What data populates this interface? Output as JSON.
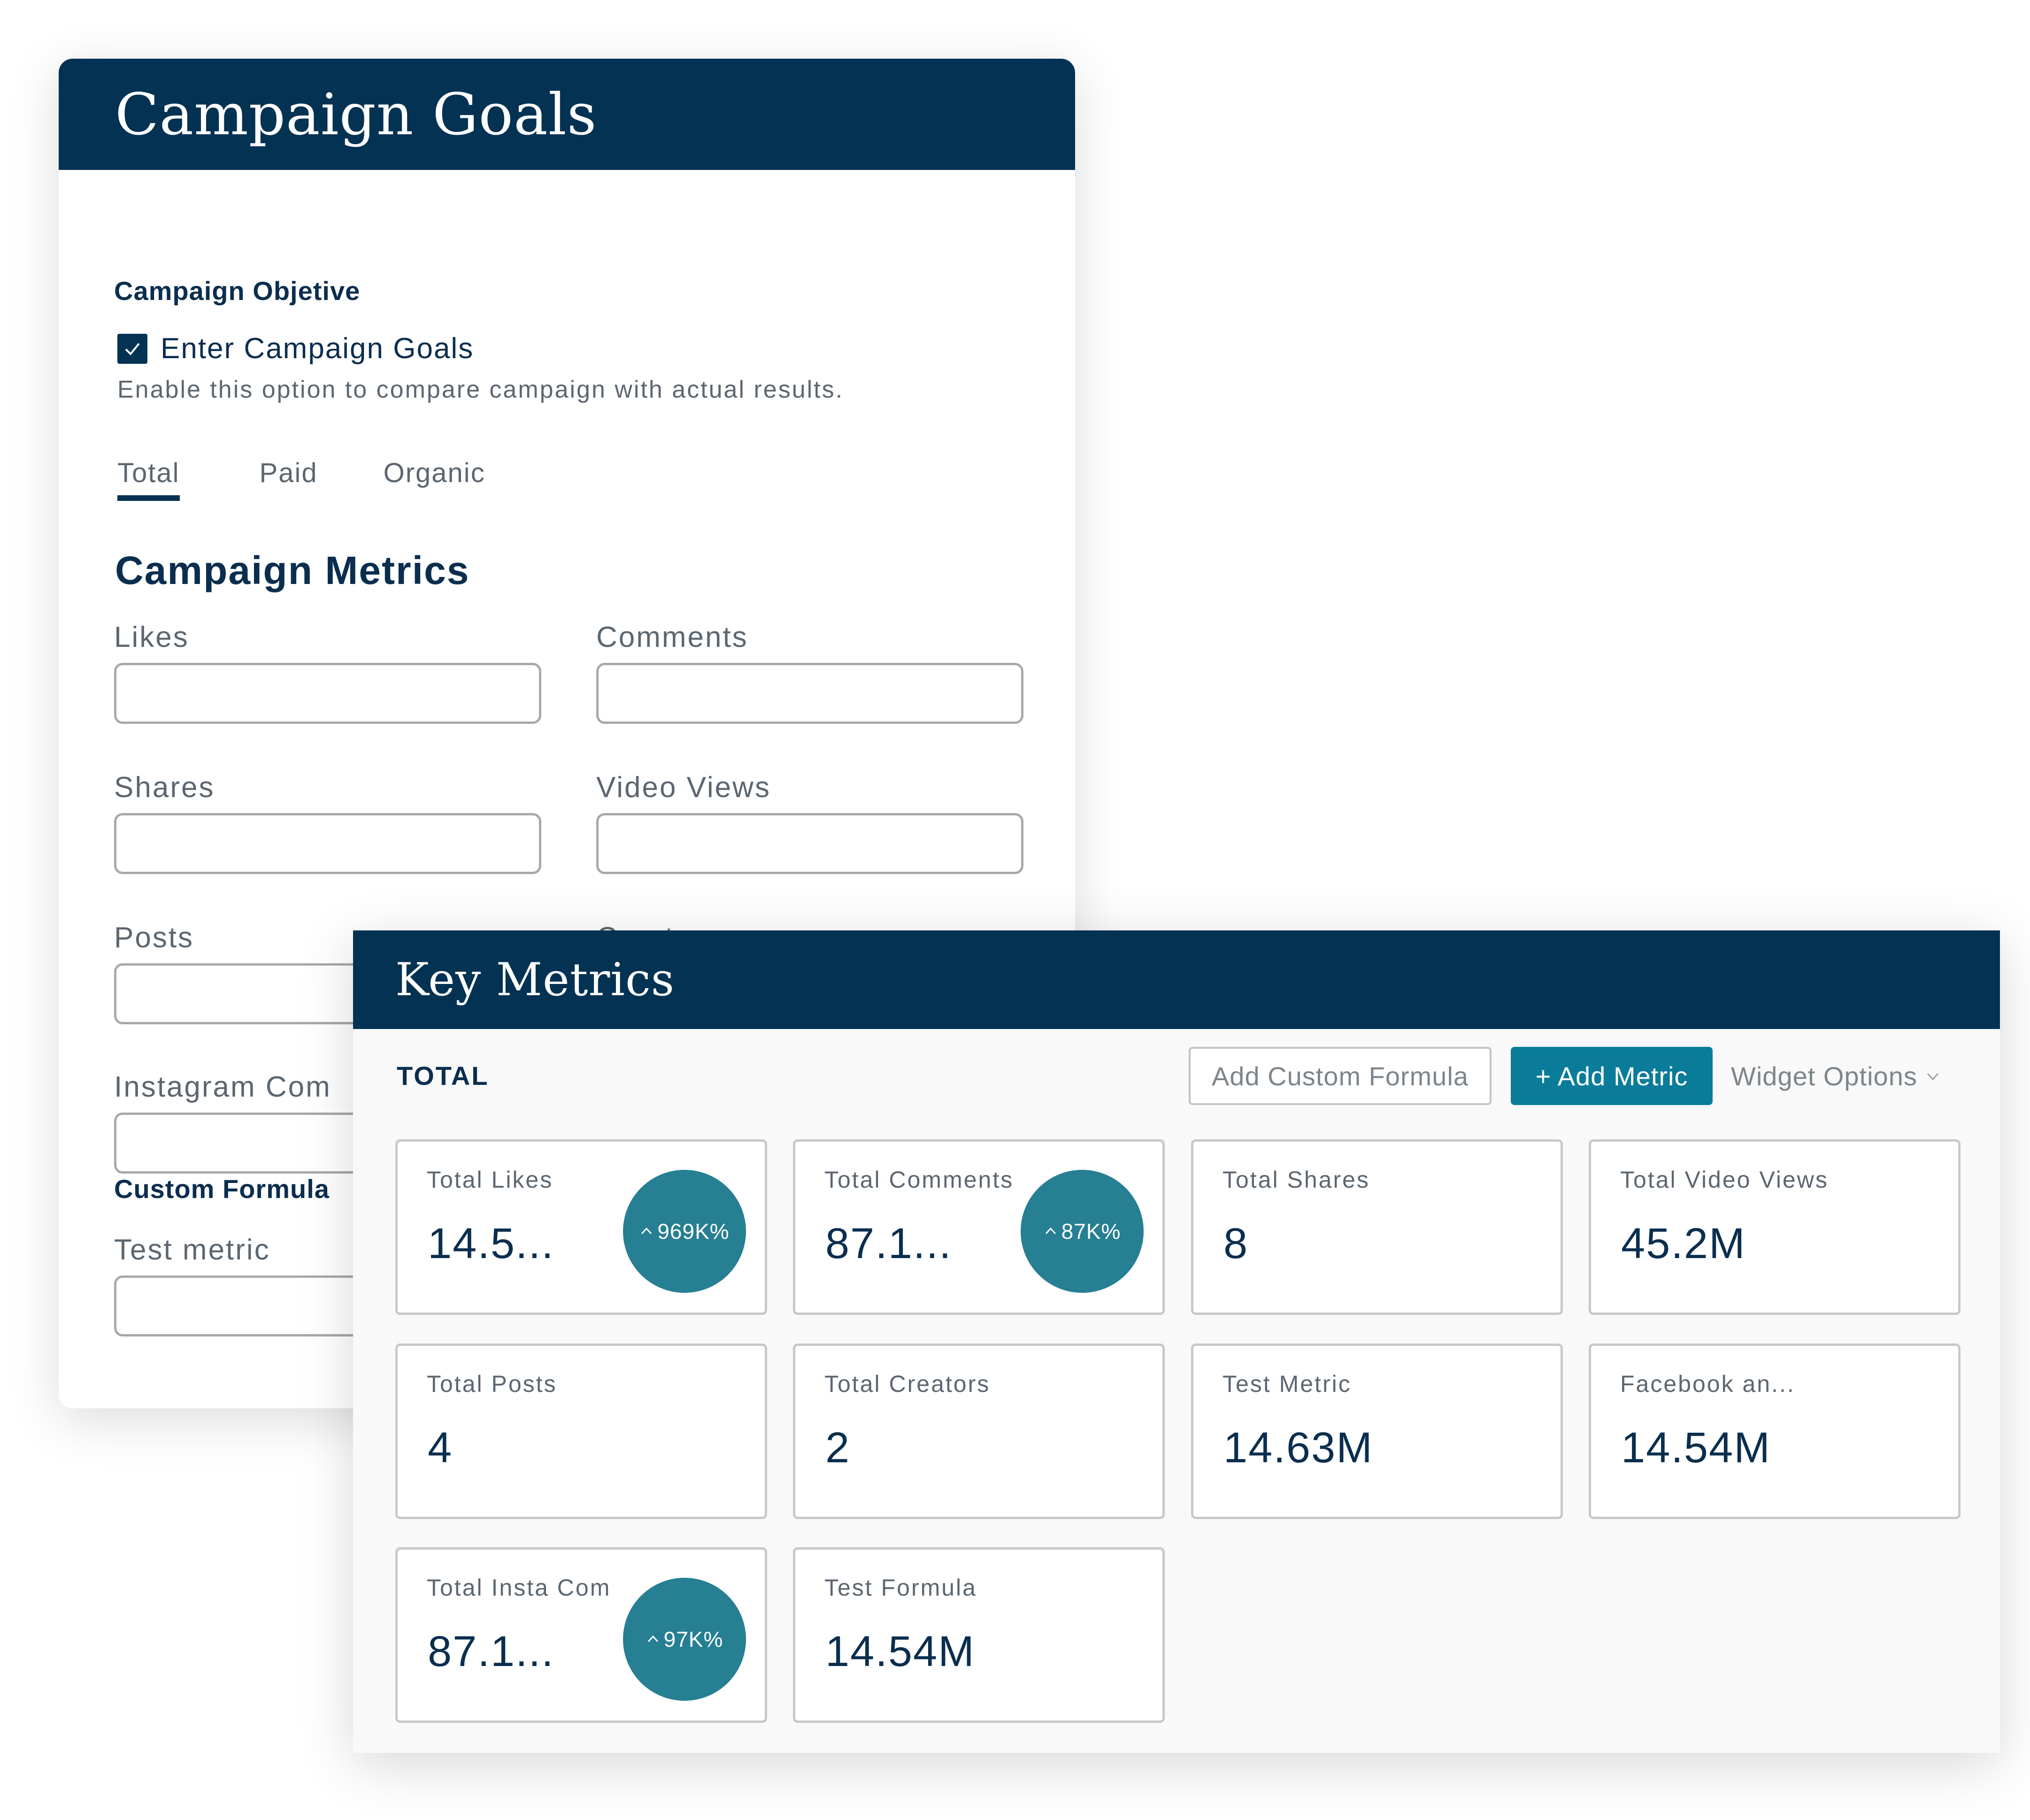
{
  "campaign_goals": {
    "title": "Campaign Goals",
    "objective_label": "Campaign Objetive",
    "checkbox": {
      "checked": true,
      "label": "Enter Campaign Goals",
      "help_text": "Enable this option to compare campaign with actual results."
    },
    "tabs": [
      {
        "label": "Total",
        "active": true
      },
      {
        "label": "Paid",
        "active": false
      },
      {
        "label": "Organic",
        "active": false
      }
    ],
    "metrics_heading": "Campaign Metrics",
    "fields": [
      {
        "label": "Likes",
        "value": ""
      },
      {
        "label": "Comments",
        "value": ""
      },
      {
        "label": "Shares",
        "value": ""
      },
      {
        "label": "Video Views",
        "value": ""
      },
      {
        "label": "Posts",
        "value": ""
      },
      {
        "label": "Creators",
        "value": ""
      },
      {
        "label": "Instagram Com",
        "value": ""
      }
    ],
    "custom_formula_label": "Custom Formula",
    "custom_fields": [
      {
        "label": "Test metric",
        "value": ""
      }
    ]
  },
  "key_metrics": {
    "title": "Key Metrics",
    "total_label": "TOTAL",
    "add_custom_formula_label": "Add Custom Formula",
    "add_metric_label": "+ Add Metric",
    "widget_options_label": "Widget Options",
    "widget_options_icon": "chevron-down-icon",
    "tiles": [
      {
        "label": "Total Likes",
        "value": "14.5...",
        "badge": "969K%",
        "badge_icon": "caret-up-icon"
      },
      {
        "label": "Total Comments",
        "value": "87.1...",
        "badge": "87K%",
        "badge_icon": "caret-up-icon"
      },
      {
        "label": "Total Shares",
        "value": "8"
      },
      {
        "label": "Total Video Views",
        "value": "45.2M"
      },
      {
        "label": "Total Posts",
        "value": "4"
      },
      {
        "label": "Total Creators",
        "value": "2"
      },
      {
        "label": "Test Metric",
        "value": "14.63M"
      },
      {
        "label": "Facebook an...",
        "value": "14.54M"
      },
      {
        "label": "Total Insta Com",
        "value": "87.1...",
        "badge": "97K%",
        "badge_icon": "caret-up-icon"
      },
      {
        "label": "Test Formula",
        "value": "14.54M"
      }
    ]
  },
  "colors": {
    "header_navy": "#033253",
    "text_navy": "#0b2e4f",
    "accent_teal": "#0a7c99",
    "badge_teal": "#267f93",
    "muted_text": "#5c6670",
    "border_gray": "#a6a9ac"
  }
}
